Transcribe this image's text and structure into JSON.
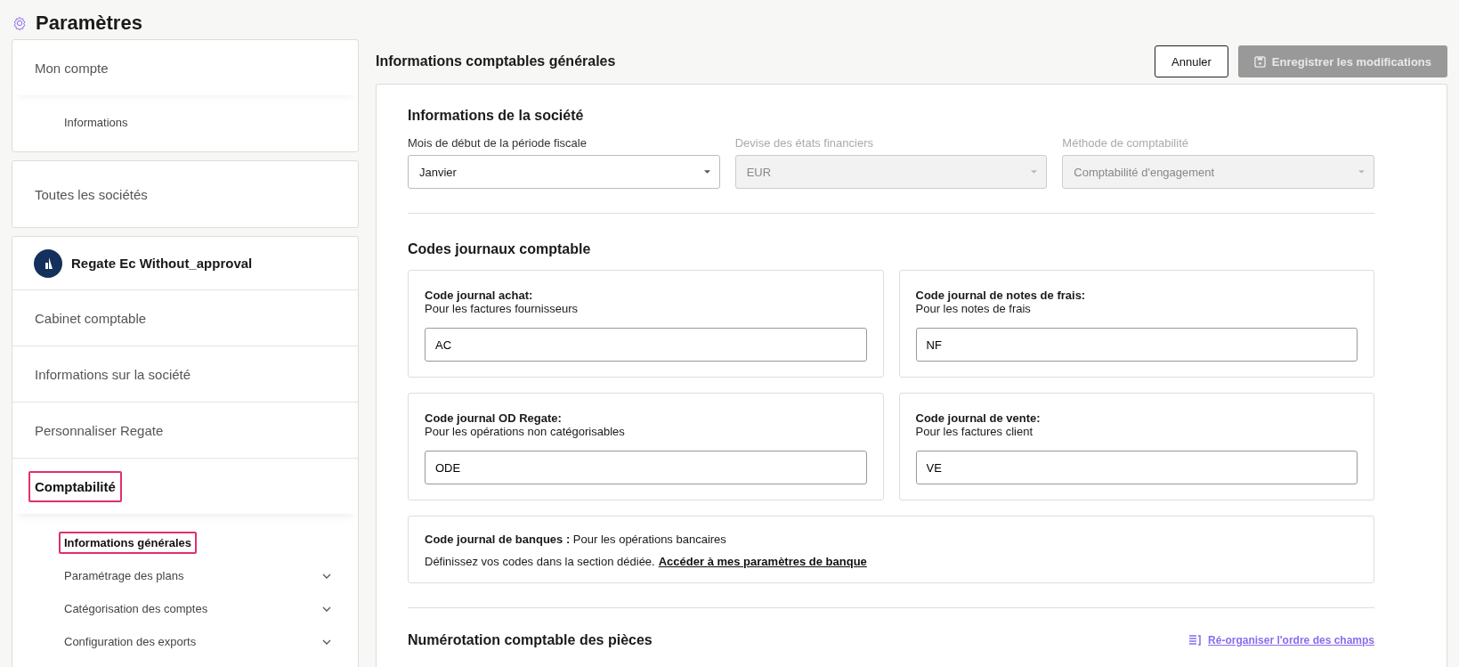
{
  "page": {
    "title": "Paramètres"
  },
  "sidebar": {
    "account": {
      "title": "Mon compte",
      "items": [
        {
          "label": "Informations",
          "selected": false,
          "highlighted": false
        }
      ]
    },
    "all_companies": {
      "label": "Toutes les sociétés"
    },
    "company": {
      "name": "Regate Ec Without_approval",
      "menu": [
        {
          "label": "Cabinet comptable",
          "selected": false,
          "highlighted": false
        },
        {
          "label": "Informations sur la société",
          "selected": false,
          "highlighted": false
        },
        {
          "label": "Personnaliser Regate",
          "selected": false,
          "highlighted": false
        },
        {
          "label": "Comptabilité",
          "selected": true,
          "highlighted": true
        }
      ],
      "submenu": [
        {
          "label": "Informations générales",
          "selected": true,
          "highlighted": true,
          "expandable": false
        },
        {
          "label": "Paramétrage des plans",
          "selected": false,
          "highlighted": false,
          "expandable": true
        },
        {
          "label": "Catégorisation des comptes",
          "selected": false,
          "highlighted": false,
          "expandable": true
        },
        {
          "label": "Configuration des exports",
          "selected": false,
          "highlighted": false,
          "expandable": true
        }
      ]
    }
  },
  "main": {
    "title": "Informations comptables générales",
    "buttons": [
      {
        "label": "Annuler",
        "kind": "secondary",
        "disabled": false
      },
      {
        "label": "Enregistrer les modifications",
        "kind": "save",
        "disabled": true
      }
    ],
    "company_info": {
      "title": "Informations de la société",
      "fields": [
        {
          "label": "Mois de début de la période fiscale",
          "value": "Janvier",
          "disabled": false
        },
        {
          "label": "Devise des états financiers",
          "value": "EUR",
          "disabled": true
        },
        {
          "label": "Méthode de comptabilité",
          "value": "Comptabilité d'engagement",
          "disabled": true
        }
      ]
    },
    "journal_codes": {
      "title": "Codes journaux comptable",
      "cards": [
        {
          "label": "Code journal achat:",
          "hint": "Pour les factures fournisseurs",
          "value": "AC"
        },
        {
          "label": "Code journal de notes de frais:",
          "hint": "Pour les notes de frais",
          "value": "NF"
        },
        {
          "label": "Code journal OD Regate:",
          "hint": "Pour les opérations non catégorisables",
          "value": "ODE"
        },
        {
          "label": "Code journal de vente:",
          "hint": "Pour les factures client",
          "value": "VE"
        }
      ],
      "bank": {
        "line": "**Code journal de banques :** Pour les opérations bancaires",
        "text": "Définissez vos codes dans la section dédiée.",
        "link": "Accéder à mes paramètres de banque"
      }
    },
    "numbering": {
      "title": "Numérotation comptable des pièces",
      "link": "Ré-organiser l'ordre des champs"
    }
  }
}
